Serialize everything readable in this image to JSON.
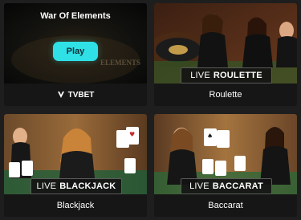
{
  "games": [
    {
      "id": "war-of-elements",
      "title": "War Of Elements",
      "play_label": "Play",
      "provider": "TVBET",
      "bg_text": "ELEMENTS"
    },
    {
      "id": "roulette",
      "banner_live": "LIVE",
      "banner_name": "ROULETTE",
      "caption": "Roulette"
    },
    {
      "id": "blackjack",
      "banner_live": "LIVE",
      "banner_name": "BLACKJACK",
      "caption": "Blackjack"
    },
    {
      "id": "baccarat",
      "banner_live": "LIVE",
      "banner_name": "BACCARAT",
      "caption": "Baccarat"
    }
  ],
  "colors": {
    "page_bg": "#1e1e1e",
    "card_bg": "#121212",
    "play_button": "#2fe0e6",
    "banner_bg": "#141414"
  }
}
